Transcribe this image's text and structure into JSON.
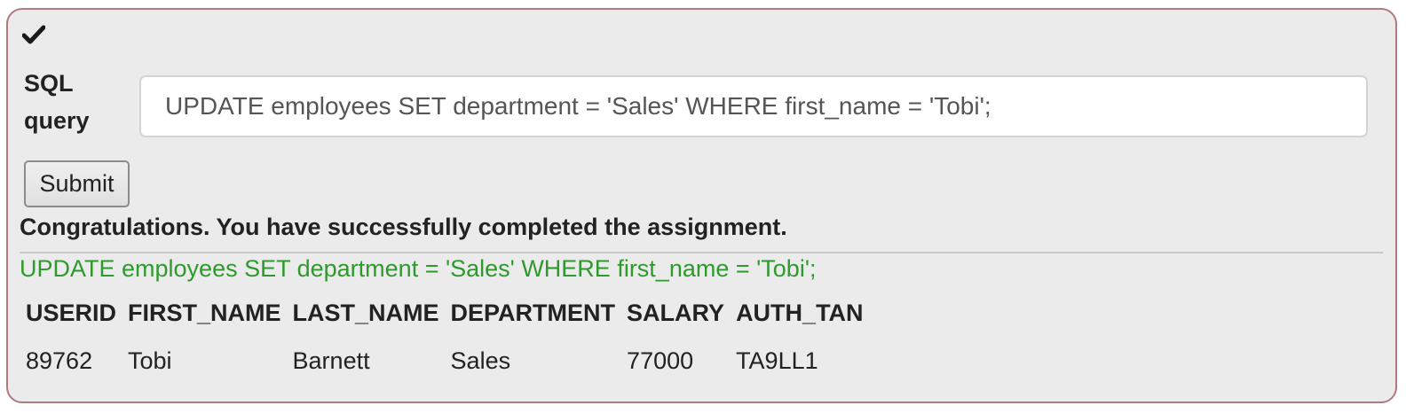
{
  "form": {
    "status_icon": "checkmark-icon",
    "label": "SQL query",
    "query_value": "UPDATE employees SET department = 'Sales' WHERE first_name = 'Tobi';",
    "submit_label": "Submit"
  },
  "result": {
    "feedback": "Congratulations. You have successfully completed the assignment.",
    "executed_query": "UPDATE employees SET department = 'Sales' WHERE first_name = 'Tobi';",
    "query_color": "#2e9a2e",
    "columns": [
      "USERID",
      "FIRST_NAME",
      "LAST_NAME",
      "DEPARTMENT",
      "SALARY",
      "AUTH_TAN"
    ],
    "rows": [
      [
        "89762",
        "Tobi",
        "Barnett",
        "Sales",
        "77000",
        "TA9LL1"
      ]
    ]
  }
}
